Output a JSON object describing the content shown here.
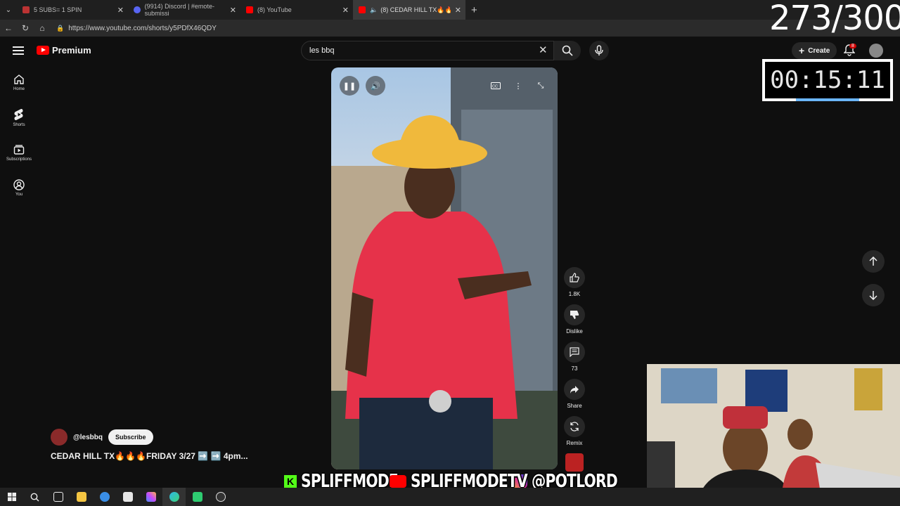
{
  "browser": {
    "tabs": [
      {
        "title": "5 SUBS= 1 SPIN",
        "active": false,
        "color": "#b33"
      },
      {
        "title": "(9914) Discord | #emote-submissi",
        "active": false,
        "color": "#5865f2"
      },
      {
        "title": "(8) YouTube",
        "active": false,
        "color": "#ff0000"
      },
      {
        "title": "(8) CEDAR HILL TX🔥🔥🔥FRI",
        "active": true,
        "color": "#ff0000"
      }
    ],
    "url": "https://www.youtube.com/shorts/y5PDfX46QDY"
  },
  "youtube": {
    "logo_text": "Premium",
    "search_query": "les bbq",
    "create_label": "Create",
    "notif_count": "8",
    "sidebar": [
      {
        "label": "Home",
        "icon": "home-icon"
      },
      {
        "label": "Shorts",
        "icon": "shorts-icon"
      },
      {
        "label": "Subscriptions",
        "icon": "subscriptions-icon"
      },
      {
        "label": "You",
        "icon": "you-icon"
      }
    ],
    "actions": {
      "likes": "1.8K",
      "dislike": "Dislike",
      "comments": "73",
      "share": "Share",
      "remix": "Remix"
    },
    "channel": "@lesbbq",
    "subscribe": "Subscribe",
    "video_title": "CEDAR HILL TX🔥🔥🔥FRIDAY 3/27 ➡️ ➡️ 4pm..."
  },
  "overlay": {
    "counter": "273/300",
    "timer": "00:15:11",
    "banner_1": "SPLIFFMODE",
    "banner_2": "SPLIFFMODETV",
    "banner_3": "@POTLORD"
  }
}
